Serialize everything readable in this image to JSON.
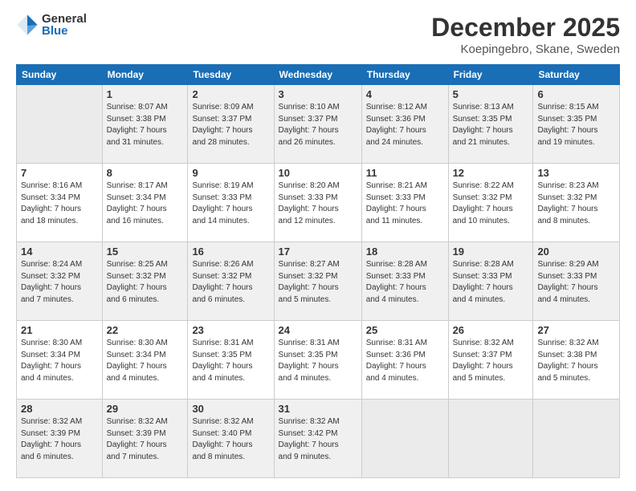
{
  "logo": {
    "general": "General",
    "blue": "Blue"
  },
  "header": {
    "month": "December 2025",
    "location": "Koepingebro, Skane, Sweden"
  },
  "weekdays": [
    "Sunday",
    "Monday",
    "Tuesday",
    "Wednesday",
    "Thursday",
    "Friday",
    "Saturday"
  ],
  "weeks": [
    [
      {
        "day": "",
        "info": ""
      },
      {
        "day": "1",
        "info": "Sunrise: 8:07 AM\nSunset: 3:38 PM\nDaylight: 7 hours\nand 31 minutes."
      },
      {
        "day": "2",
        "info": "Sunrise: 8:09 AM\nSunset: 3:37 PM\nDaylight: 7 hours\nand 28 minutes."
      },
      {
        "day": "3",
        "info": "Sunrise: 8:10 AM\nSunset: 3:37 PM\nDaylight: 7 hours\nand 26 minutes."
      },
      {
        "day": "4",
        "info": "Sunrise: 8:12 AM\nSunset: 3:36 PM\nDaylight: 7 hours\nand 24 minutes."
      },
      {
        "day": "5",
        "info": "Sunrise: 8:13 AM\nSunset: 3:35 PM\nDaylight: 7 hours\nand 21 minutes."
      },
      {
        "day": "6",
        "info": "Sunrise: 8:15 AM\nSunset: 3:35 PM\nDaylight: 7 hours\nand 19 minutes."
      }
    ],
    [
      {
        "day": "7",
        "info": "Sunrise: 8:16 AM\nSunset: 3:34 PM\nDaylight: 7 hours\nand 18 minutes."
      },
      {
        "day": "8",
        "info": "Sunrise: 8:17 AM\nSunset: 3:34 PM\nDaylight: 7 hours\nand 16 minutes."
      },
      {
        "day": "9",
        "info": "Sunrise: 8:19 AM\nSunset: 3:33 PM\nDaylight: 7 hours\nand 14 minutes."
      },
      {
        "day": "10",
        "info": "Sunrise: 8:20 AM\nSunset: 3:33 PM\nDaylight: 7 hours\nand 12 minutes."
      },
      {
        "day": "11",
        "info": "Sunrise: 8:21 AM\nSunset: 3:33 PM\nDaylight: 7 hours\nand 11 minutes."
      },
      {
        "day": "12",
        "info": "Sunrise: 8:22 AM\nSunset: 3:32 PM\nDaylight: 7 hours\nand 10 minutes."
      },
      {
        "day": "13",
        "info": "Sunrise: 8:23 AM\nSunset: 3:32 PM\nDaylight: 7 hours\nand 8 minutes."
      }
    ],
    [
      {
        "day": "14",
        "info": "Sunrise: 8:24 AM\nSunset: 3:32 PM\nDaylight: 7 hours\nand 7 minutes."
      },
      {
        "day": "15",
        "info": "Sunrise: 8:25 AM\nSunset: 3:32 PM\nDaylight: 7 hours\nand 6 minutes."
      },
      {
        "day": "16",
        "info": "Sunrise: 8:26 AM\nSunset: 3:32 PM\nDaylight: 7 hours\nand 6 minutes."
      },
      {
        "day": "17",
        "info": "Sunrise: 8:27 AM\nSunset: 3:32 PM\nDaylight: 7 hours\nand 5 minutes."
      },
      {
        "day": "18",
        "info": "Sunrise: 8:28 AM\nSunset: 3:33 PM\nDaylight: 7 hours\nand 4 minutes."
      },
      {
        "day": "19",
        "info": "Sunrise: 8:28 AM\nSunset: 3:33 PM\nDaylight: 7 hours\nand 4 minutes."
      },
      {
        "day": "20",
        "info": "Sunrise: 8:29 AM\nSunset: 3:33 PM\nDaylight: 7 hours\nand 4 minutes."
      }
    ],
    [
      {
        "day": "21",
        "info": "Sunrise: 8:30 AM\nSunset: 3:34 PM\nDaylight: 7 hours\nand 4 minutes."
      },
      {
        "day": "22",
        "info": "Sunrise: 8:30 AM\nSunset: 3:34 PM\nDaylight: 7 hours\nand 4 minutes."
      },
      {
        "day": "23",
        "info": "Sunrise: 8:31 AM\nSunset: 3:35 PM\nDaylight: 7 hours\nand 4 minutes."
      },
      {
        "day": "24",
        "info": "Sunrise: 8:31 AM\nSunset: 3:35 PM\nDaylight: 7 hours\nand 4 minutes."
      },
      {
        "day": "25",
        "info": "Sunrise: 8:31 AM\nSunset: 3:36 PM\nDaylight: 7 hours\nand 4 minutes."
      },
      {
        "day": "26",
        "info": "Sunrise: 8:32 AM\nSunset: 3:37 PM\nDaylight: 7 hours\nand 5 minutes."
      },
      {
        "day": "27",
        "info": "Sunrise: 8:32 AM\nSunset: 3:38 PM\nDaylight: 7 hours\nand 5 minutes."
      }
    ],
    [
      {
        "day": "28",
        "info": "Sunrise: 8:32 AM\nSunset: 3:39 PM\nDaylight: 7 hours\nand 6 minutes."
      },
      {
        "day": "29",
        "info": "Sunrise: 8:32 AM\nSunset: 3:39 PM\nDaylight: 7 hours\nand 7 minutes."
      },
      {
        "day": "30",
        "info": "Sunrise: 8:32 AM\nSunset: 3:40 PM\nDaylight: 7 hours\nand 8 minutes."
      },
      {
        "day": "31",
        "info": "Sunrise: 8:32 AM\nSunset: 3:42 PM\nDaylight: 7 hours\nand 9 minutes."
      },
      {
        "day": "",
        "info": ""
      },
      {
        "day": "",
        "info": ""
      },
      {
        "day": "",
        "info": ""
      }
    ]
  ]
}
